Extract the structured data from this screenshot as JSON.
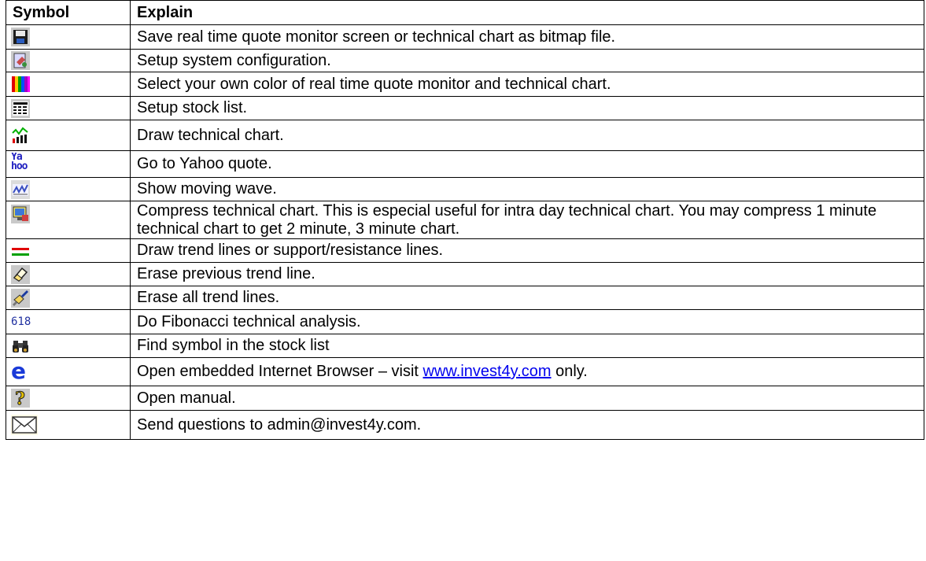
{
  "header": {
    "symbol": "Symbol",
    "explain": "Explain"
  },
  "rows": [
    {
      "icon": "save-icon",
      "text": "Save real time quote monitor screen or technical chart as bitmap file."
    },
    {
      "icon": "setup-config-icon",
      "text": "Setup system configuration."
    },
    {
      "icon": "color-bars-icon",
      "text": "Select your own color of real time quote monitor and technical chart."
    },
    {
      "icon": "stock-list-icon",
      "text": "Setup stock list."
    },
    {
      "icon": "technical-chart-icon",
      "text": "Draw technical chart."
    },
    {
      "icon": "yahoo-icon",
      "text": "Go to Yahoo quote.",
      "icon_text": "Ya hoo"
    },
    {
      "icon": "moving-wave-icon",
      "text": "Show moving wave."
    },
    {
      "icon": "compress-chart-icon",
      "text": "Compress technical chart. This is especial useful for intra day technical chart. You may compress 1 minute technical chart to get 2 minute, 3 minute chart."
    },
    {
      "icon": "trend-lines-icon",
      "text": "Draw trend lines or support/resistance lines."
    },
    {
      "icon": "eraser-icon",
      "text": "Erase previous trend line."
    },
    {
      "icon": "brush-icon",
      "text": "Erase all trend lines."
    },
    {
      "icon": "fibonacci-icon",
      "text": "Do Fibonacci technical analysis.",
      "icon_text": "618"
    },
    {
      "icon": "binoculars-icon",
      "text": "Find symbol in the stock list"
    },
    {
      "icon": "internet-explorer-icon",
      "text_before": "Open embedded Internet Browser – visit ",
      "link": "www.invest4y.com",
      "text_after": " only."
    },
    {
      "icon": "help-icon",
      "text": "Open manual."
    },
    {
      "icon": "envelope-icon",
      "text": "Send questions to admin@invest4y.com."
    }
  ]
}
